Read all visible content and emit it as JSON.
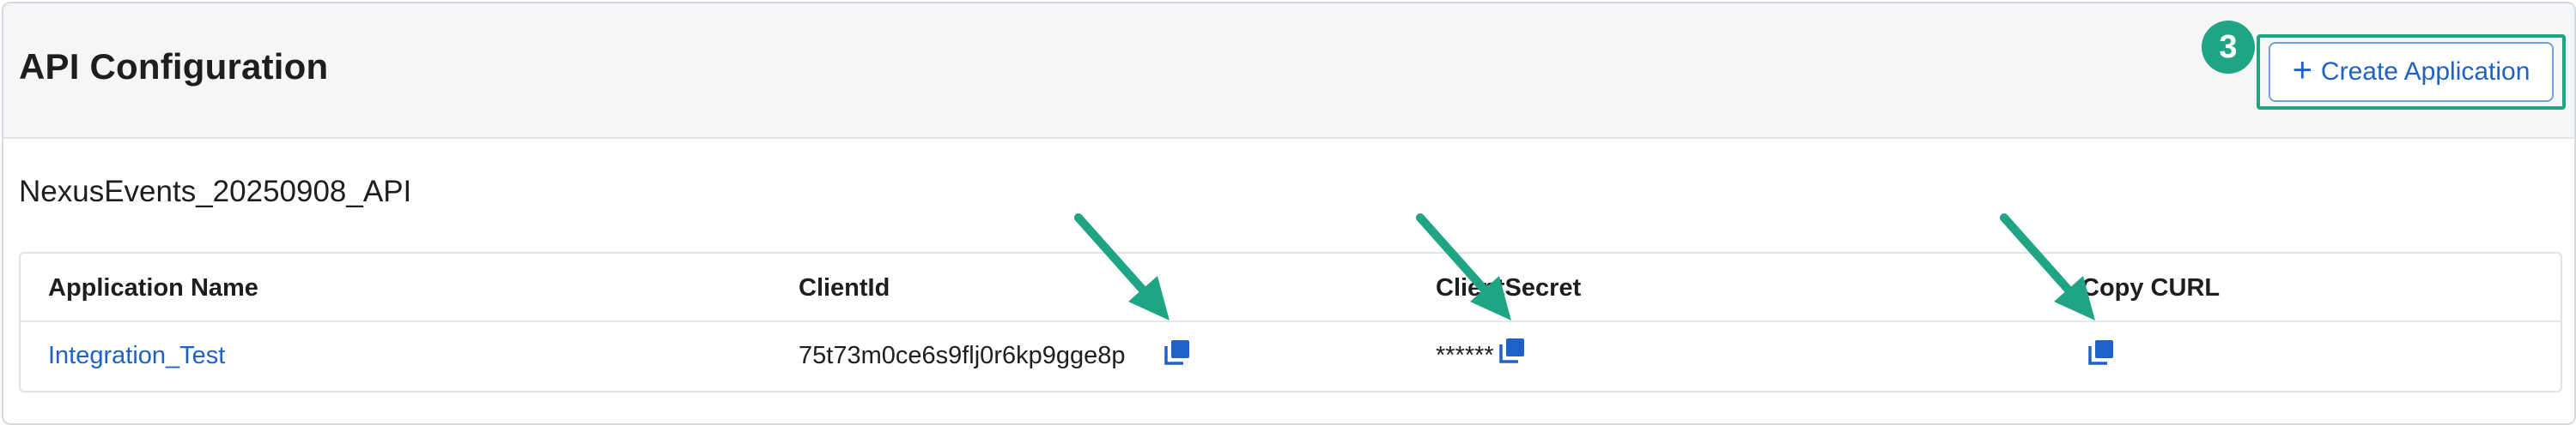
{
  "header": {
    "title": "API Configuration",
    "step_badge": "3",
    "create_button_label": "Create Application"
  },
  "section": {
    "title": "NexusEvents_20250908_API"
  },
  "table": {
    "columns": [
      "Application Name",
      "ClientId",
      "ClientSecret",
      "Copy CURL"
    ],
    "rows": [
      {
        "application_name": "Integration_Test",
        "client_id": "75t73m0ce6s9flj0r6kp9gge8p",
        "client_secret": "******"
      }
    ]
  },
  "icons": {
    "plus": "plus-icon",
    "copy": "copy-icon",
    "annotation_arrow": "arrow-icon"
  },
  "colors": {
    "accent_green": "#1fa584",
    "link_blue": "#1f62c7",
    "header_bg": "#f5f6f8"
  }
}
